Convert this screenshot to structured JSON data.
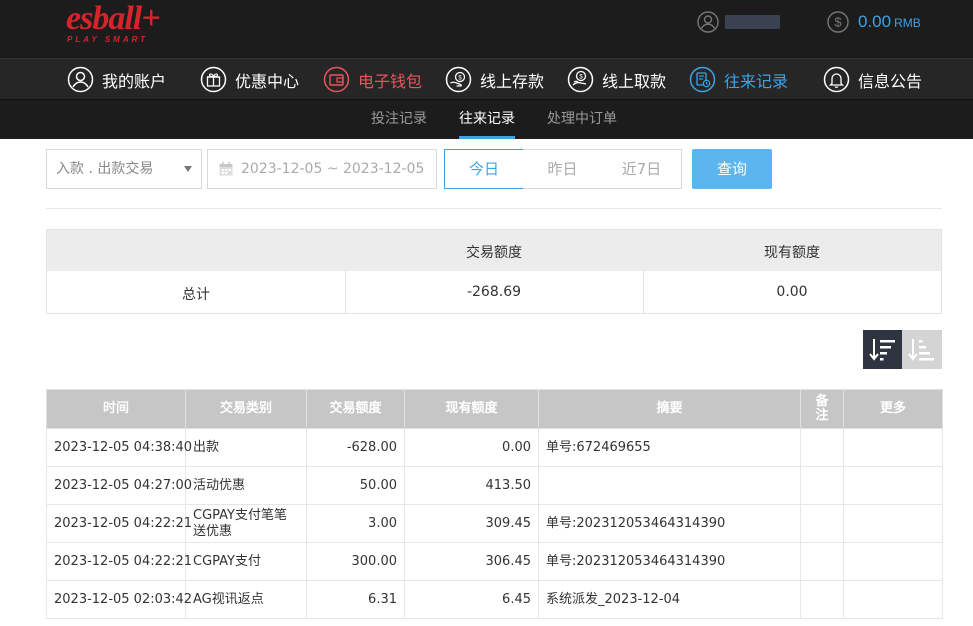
{
  "header": {
    "logo_text": "esball+",
    "logo_tagline": "PLAY SMART",
    "balance": "0.00",
    "balance_unit": "RMB",
    "user_icon": "user-circle-icon",
    "coin_icon": "dollar-circle-icon"
  },
  "colors": {
    "brand_red": "#d8232a",
    "accent_blue": "#3ba4e8",
    "topbar_bg": "#1c1c1c",
    "search_button": "#5bb6f0"
  },
  "nav": {
    "items": [
      {
        "label": "我的账户",
        "icon": "user-icon"
      },
      {
        "label": "优惠中心",
        "icon": "gift-icon"
      },
      {
        "label": "电子钱包",
        "icon": "wallet-icon"
      },
      {
        "label": "线上存款",
        "icon": "deposit-icon"
      },
      {
        "label": "线上取款",
        "icon": "withdraw-icon"
      },
      {
        "label": "往来记录",
        "icon": "records-icon"
      },
      {
        "label": "信息公告",
        "icon": "bell-icon"
      }
    ]
  },
  "subnav": {
    "items": [
      {
        "label": "投注记录"
      },
      {
        "label": "往来记录"
      },
      {
        "label": "处理中订单"
      }
    ]
  },
  "filter": {
    "type_select": "入款 . 出款交易",
    "date_range": "2023-12-05 ~ 2023-12-05",
    "quick": [
      "今日",
      "昨日",
      "近7日"
    ],
    "search_label": "查询"
  },
  "summary": {
    "headers": [
      "交易额度",
      "现有额度"
    ],
    "row_label": "总计",
    "amount": "-268.69",
    "balance": "0.00"
  },
  "table": {
    "headers": [
      "时间",
      "交易类别",
      "交易额度",
      "现有额度",
      "摘要",
      "备注",
      "更多"
    ],
    "rows": [
      {
        "time": "2023-12-05 04:38:40",
        "type": "出款",
        "amount": "-628.00",
        "balance": "0.00",
        "summary": "单号:672469655",
        "remark": "",
        "more": ""
      },
      {
        "time": "2023-12-05 04:27:00",
        "type": "活动优惠",
        "amount": "50.00",
        "balance": "413.50",
        "summary": "",
        "remark": "",
        "more": ""
      },
      {
        "time": "2023-12-05 04:22:21",
        "type": "CGPAY支付笔笔送优惠",
        "amount": "3.00",
        "balance": "309.45",
        "summary": "单号:202312053464314390",
        "remark": "",
        "more": ""
      },
      {
        "time": "2023-12-05 04:22:21",
        "type": "CGPAY支付",
        "amount": "300.00",
        "balance": "306.45",
        "summary": "单号:202312053464314390",
        "remark": "",
        "more": ""
      },
      {
        "time": "2023-12-05 02:03:42",
        "type": "AG视讯返点",
        "amount": "6.31",
        "balance": "6.45",
        "summary": "系统派发_2023-12-04",
        "remark": "",
        "more": ""
      }
    ]
  }
}
